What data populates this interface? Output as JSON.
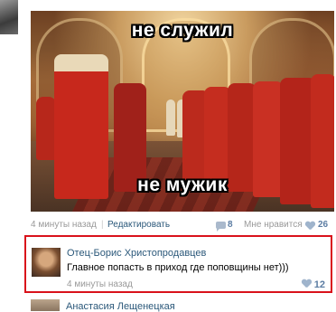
{
  "post": {
    "meme_top": "не служил",
    "meme_bottom": "не мужик",
    "time": "4 минуты назад",
    "separator": "|",
    "edit_label": "Редактировать",
    "comments_count": "8",
    "like_label": "Мне нравится",
    "likes_count": "26"
  },
  "highlighted_comment": {
    "author": "Отец-Борис Христопродавцев",
    "text": "Главное попасть в приход где поповщины нет)))",
    "time": "4 минуты назад",
    "likes": "12"
  },
  "next_comment": {
    "author": "Анастасия Лещенецкая"
  },
  "colors": {
    "link": "#2b587a",
    "highlight_border": "#d9121b",
    "meta_gray": "#999999",
    "like_blue": "#5c7da3"
  }
}
